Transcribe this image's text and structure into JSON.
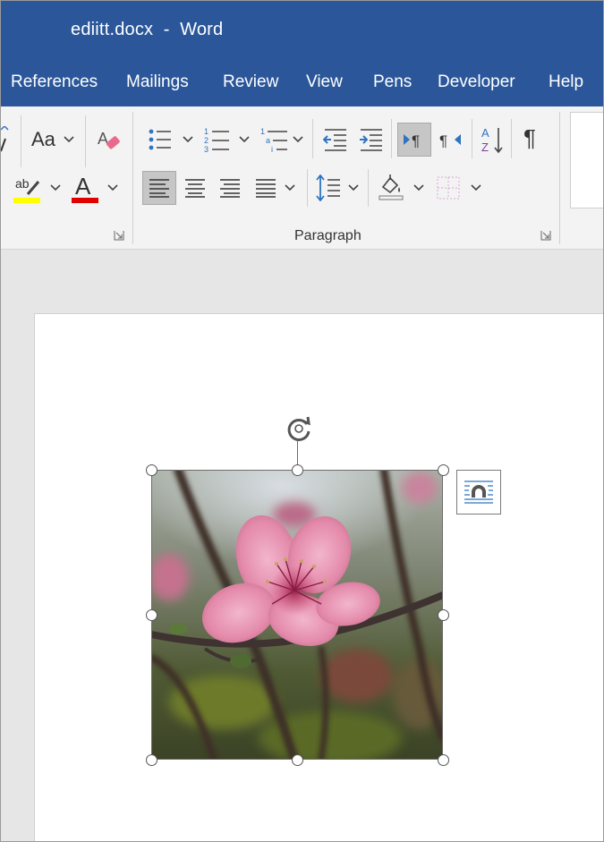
{
  "window": {
    "title": "ediitt.docx  -  Word"
  },
  "ribbon_tabs": [
    "References",
    "Mailings",
    "Review",
    "View",
    "Pens",
    "Developer",
    "Help"
  ],
  "font_group": {
    "change_case_label": "Aa",
    "highlight_glyph": "ab",
    "font_color_glyph": "A",
    "highlight_color": "#ffff00",
    "font_color": "#e00000"
  },
  "paragraph_group": {
    "label": "Paragraph",
    "show_marks_glyph": "¶"
  },
  "colors": {
    "accent": "#2b579a",
    "ribbon_bg": "#f3f3f3",
    "doc_bg": "#e6e6e6"
  },
  "image": {
    "subject": "pink blossom photo",
    "selected": "true"
  }
}
